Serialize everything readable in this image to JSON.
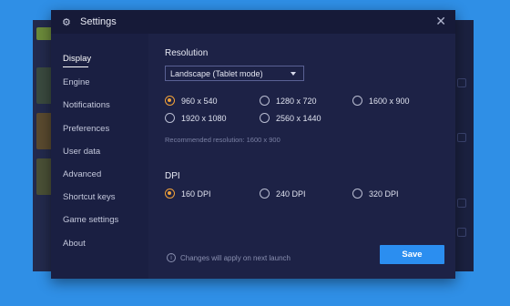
{
  "window": {
    "title": "Settings",
    "close_icon": "close-icon",
    "settings_icon": "gear-icon"
  },
  "sidebar": {
    "items": [
      {
        "label": "Display",
        "active": true
      },
      {
        "label": "Engine",
        "active": false
      },
      {
        "label": "Notifications",
        "active": false
      },
      {
        "label": "Preferences",
        "active": false
      },
      {
        "label": "User data",
        "active": false
      },
      {
        "label": "Advanced",
        "active": false
      },
      {
        "label": "Shortcut keys",
        "active": false
      },
      {
        "label": "Game settings",
        "active": false
      },
      {
        "label": "About",
        "active": false
      }
    ]
  },
  "display": {
    "resolution_title": "Resolution",
    "mode_selected": "Landscape (Tablet mode)",
    "resolutions": [
      {
        "label": "960 x 540",
        "checked": true
      },
      {
        "label": "1280 x 720",
        "checked": false
      },
      {
        "label": "1600 x 900",
        "checked": false
      },
      {
        "label": "1920 x 1080",
        "checked": false
      },
      {
        "label": "2560 x 1440",
        "checked": false
      }
    ],
    "recommended": "Recommended resolution: 1600 x 900",
    "dpi_title": "DPI",
    "dpis": [
      {
        "label": "160 DPI",
        "checked": true
      },
      {
        "label": "240 DPI",
        "checked": false
      },
      {
        "label": "320 DPI",
        "checked": false
      }
    ]
  },
  "footer": {
    "note": "Changes will apply on next launch",
    "info_icon": "info-icon",
    "save_label": "Save"
  },
  "colors": {
    "background": "#2f8fe6",
    "dialog": "#1d2246",
    "accent_radio": "#f0a13a",
    "save_button": "#2b8ef0"
  }
}
